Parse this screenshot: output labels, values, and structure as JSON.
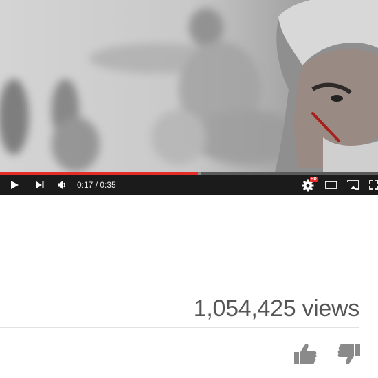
{
  "player": {
    "progress_played": 0.523,
    "progress_loaded": 0.53,
    "current_time": "0:17",
    "separator": " / ",
    "duration": "0:35",
    "hd_badge": "HD",
    "accent_color": "#e52d27",
    "icons": [
      "play-icon",
      "next-icon",
      "volume-icon",
      "settings-icon",
      "theater-mode-icon",
      "cast-icon",
      "fullscreen-icon"
    ]
  },
  "stats": {
    "views": "1,054,425 views"
  },
  "actions": {
    "icons": [
      "like-icon",
      "dislike-icon"
    ]
  }
}
